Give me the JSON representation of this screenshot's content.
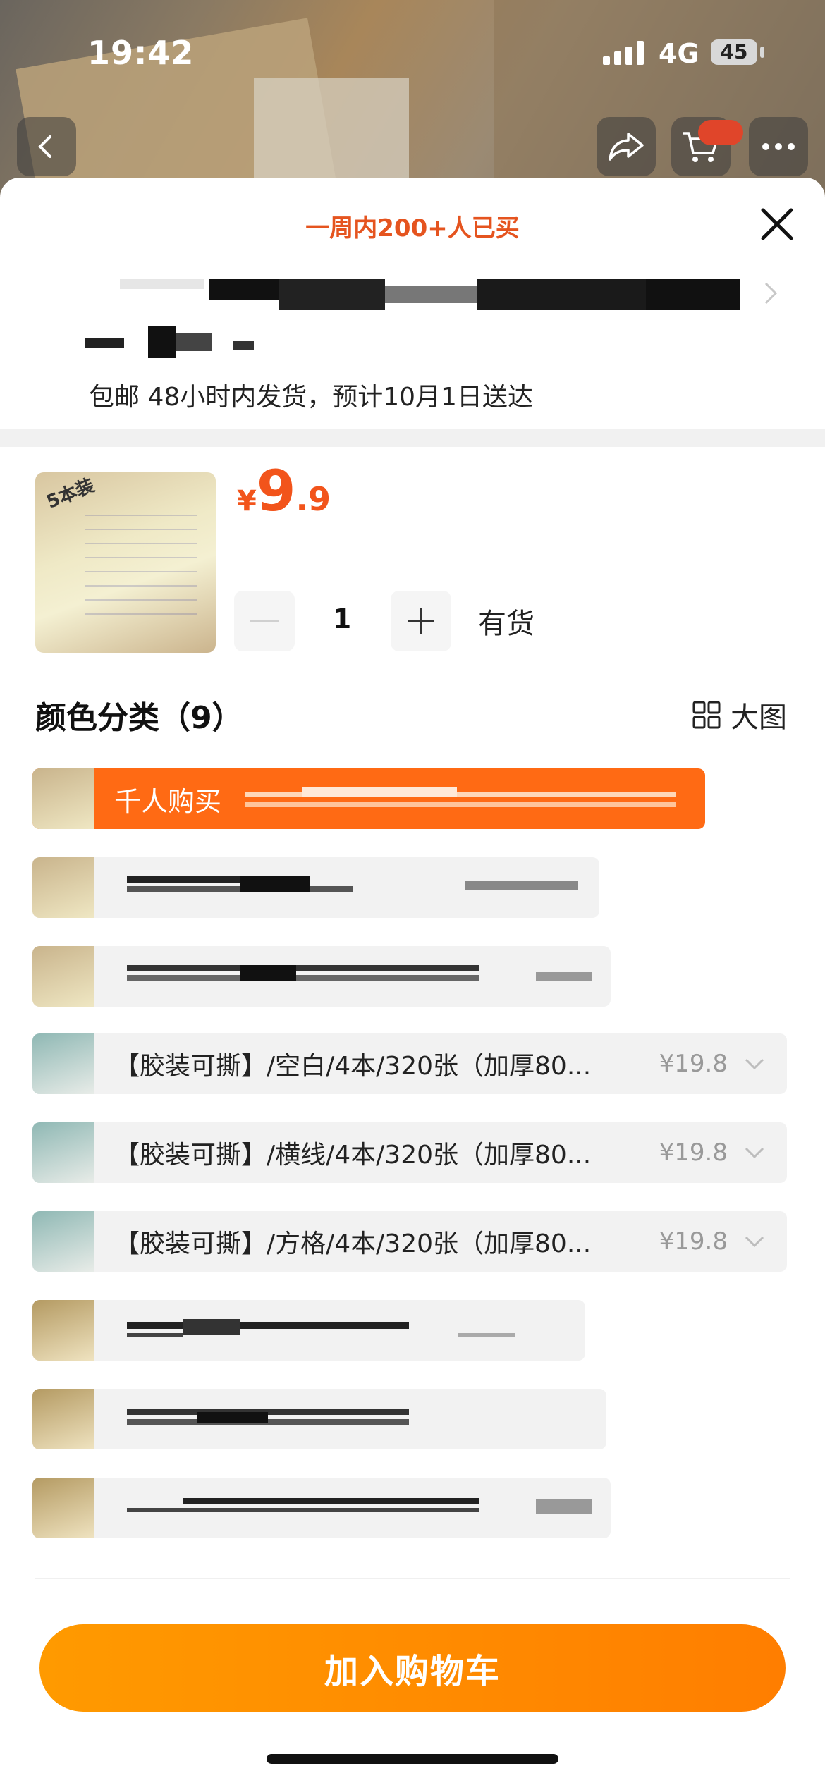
{
  "status_bar": {
    "time": "19:42",
    "network": "4G",
    "battery": "45"
  },
  "sheet": {
    "bought_text": "一周内200+人已买",
    "shipping_text": "包邮 48小时内发货，预计10月1日送达"
  },
  "product": {
    "thumb_tag": "5本装",
    "price_symbol": "¥",
    "price_int": "9",
    "price_dec": ".9",
    "quantity": "1",
    "stock": "有货"
  },
  "options": {
    "section_title": "颜色分类（9）",
    "big_image_label": "大图",
    "selected_label": "千人购买",
    "items": [
      {
        "label": "【胶装可撕】/空白/4本/320张（加厚80...",
        "price": "¥19.8"
      },
      {
        "label": "【胶装可撕】/横线/4本/320张（加厚80...",
        "price": "¥19.8"
      },
      {
        "label": "【胶装可撕】/方格/4本/320张（加厚80...",
        "price": "¥19.8"
      }
    ]
  },
  "footer": {
    "add_to_cart": "加入购物车"
  },
  "colors": {
    "accent": "#ff7e00",
    "price": "#f2541b",
    "selected": "#ff6a14"
  }
}
